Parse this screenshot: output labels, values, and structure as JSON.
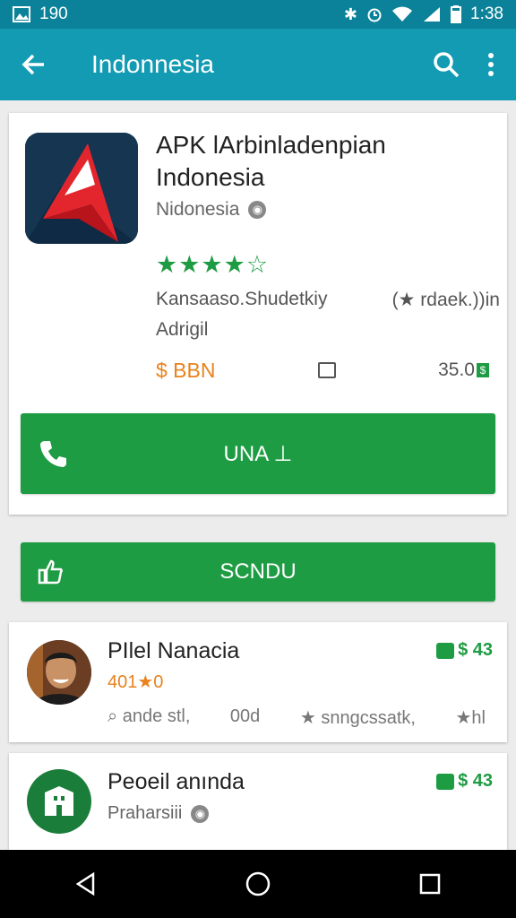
{
  "status_bar": {
    "left_text": "190",
    "time": "1:38"
  },
  "toolbar": {
    "title": "Indonnesia"
  },
  "app": {
    "title": "APK lArbinladenpian Indonesia",
    "developer": "Nidonesia",
    "rating_stars": "★★★★☆",
    "rating": 4,
    "description_left": "Kansaaso.Shudetkiy",
    "description_right": "(★ rdaek.))in",
    "description_line2": "Adrigil",
    "price": "$ BBN",
    "size": "35.0",
    "size_icon_glyph": "$"
  },
  "install_button": {
    "label": "UNA ⊥"
  },
  "send_button": {
    "label": "SCNDU"
  },
  "list": [
    {
      "title": "PIlel Nanacia",
      "badge": "$ 43",
      "subtitle": "401★0",
      "meta_1": "ande stl,",
      "meta_2": "00d",
      "meta_3": "★ snngcssatk,",
      "meta_4": "★hl"
    },
    {
      "title": "Peoeil anında",
      "badge": "$ 43",
      "subtitle": "Praharsiii",
      "meta_1": "",
      "meta_2": "",
      "meta_3": "",
      "meta_4": ""
    }
  ],
  "colors": {
    "primary": "#129bb3",
    "status": "#0b8299",
    "green": "#1e9c43",
    "orange": "#e8821d"
  }
}
